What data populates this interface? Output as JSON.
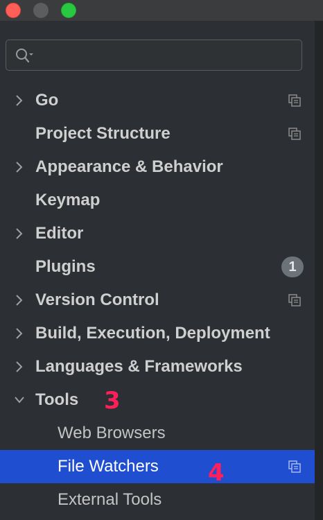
{
  "window": {
    "controls": [
      "close",
      "minimize",
      "maximize"
    ]
  },
  "search": {
    "value": "",
    "placeholder": ""
  },
  "tree": {
    "items": [
      {
        "label": "Go",
        "expandable": true,
        "expanded": false,
        "project_icon": true
      },
      {
        "label": "Project Structure",
        "expandable": false,
        "project_icon": true
      },
      {
        "label": "Appearance & Behavior",
        "expandable": true,
        "expanded": false
      },
      {
        "label": "Keymap",
        "expandable": false
      },
      {
        "label": "Editor",
        "expandable": true,
        "expanded": false
      },
      {
        "label": "Plugins",
        "expandable": false,
        "badge": "1"
      },
      {
        "label": "Version Control",
        "expandable": true,
        "expanded": false,
        "project_icon": true
      },
      {
        "label": "Build, Execution, Deployment",
        "expandable": true,
        "expanded": false
      },
      {
        "label": "Languages & Frameworks",
        "expandable": true,
        "expanded": false
      },
      {
        "label": "Tools",
        "expandable": true,
        "expanded": true
      },
      {
        "label": "Web Browsers",
        "child": true
      },
      {
        "label": "File Watchers",
        "child": true,
        "selected": true,
        "project_icon": true
      },
      {
        "label": "External Tools",
        "child": true
      }
    ]
  },
  "annotations": {
    "step3": "3",
    "step4": "4"
  },
  "colors": {
    "selection": "#1f4ed1",
    "annotation": "#ff1f5a",
    "background": "#2c2f33"
  }
}
